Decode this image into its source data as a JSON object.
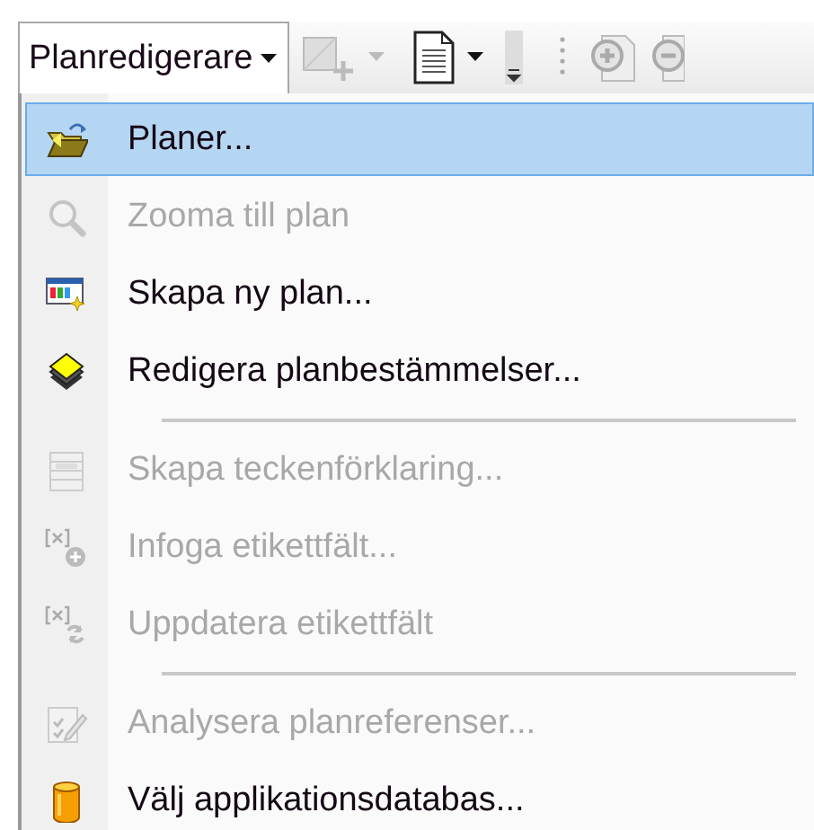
{
  "toolbar": {
    "menu_button": {
      "label": "Planredigerare",
      "expanded": true
    }
  },
  "menu": {
    "items": [
      {
        "kind": "item",
        "label": "Planer...",
        "selected": true,
        "disabled": false
      },
      {
        "kind": "item",
        "label": "Zooma till plan",
        "selected": false,
        "disabled": true
      },
      {
        "kind": "item",
        "label": "Skapa ny plan...",
        "selected": false,
        "disabled": false
      },
      {
        "kind": "item",
        "label": "Redigera planbestämmelser...",
        "selected": false,
        "disabled": false
      },
      {
        "kind": "separator"
      },
      {
        "kind": "item",
        "label": "Skapa teckenförklaring...",
        "selected": false,
        "disabled": true
      },
      {
        "kind": "item",
        "label": "Infoga etikettfält...",
        "selected": false,
        "disabled": true
      },
      {
        "kind": "item",
        "label": "Uppdatera etikettfält",
        "selected": false,
        "disabled": true
      },
      {
        "kind": "separator"
      },
      {
        "kind": "item",
        "label": "Analysera planreferenser...",
        "selected": false,
        "disabled": true
      },
      {
        "kind": "item",
        "label": "Välj applikationsdatabas...",
        "selected": false,
        "disabled": false
      }
    ]
  }
}
